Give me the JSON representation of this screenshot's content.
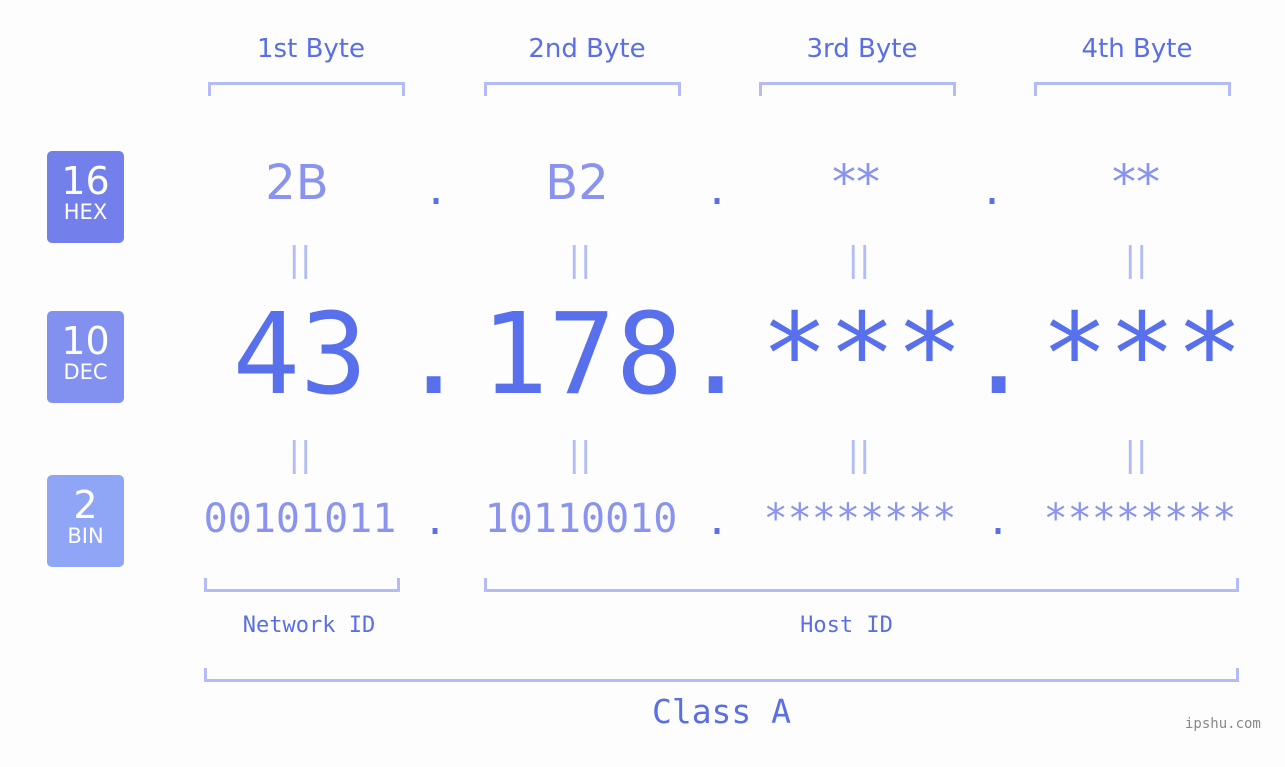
{
  "badges": [
    {
      "num": "16",
      "label": "HEX",
      "color": "#7380ec"
    },
    {
      "num": "10",
      "label": "DEC",
      "color": "#8291f0"
    },
    {
      "num": "2",
      "label": "BIN",
      "color": "#8fa6f7"
    }
  ],
  "bytes": [
    {
      "label": "1st Byte",
      "hex": "2B",
      "dec": "43",
      "bin": "00101011"
    },
    {
      "label": "2nd Byte",
      "hex": "B2",
      "dec": "178",
      "bin": "10110010"
    },
    {
      "label": "3rd Byte",
      "hex": "**",
      "dec": "***",
      "bin": "********"
    },
    {
      "label": "4th Byte",
      "hex": "**",
      "dec": "***",
      "bin": "********"
    }
  ],
  "separator": ".",
  "equals": "||",
  "network_label": "Network ID",
  "host_label": "Host ID",
  "class_label": "Class A",
  "watermark": "ipshu.com"
}
